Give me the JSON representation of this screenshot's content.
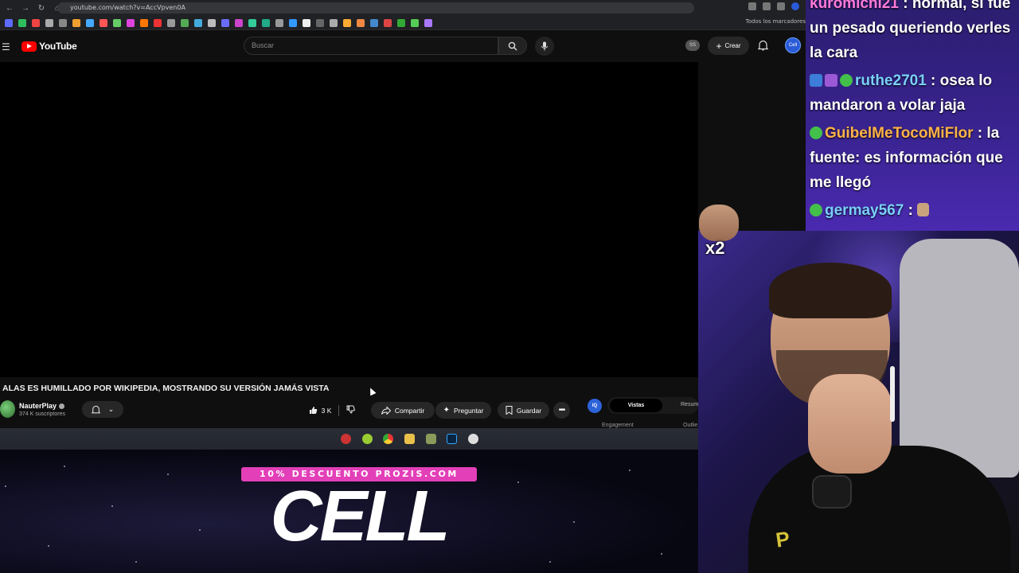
{
  "browser": {
    "url": "youtube.com/watch?v=AccVpven0A",
    "bookmarks_label": "Todos los marcadores"
  },
  "youtube": {
    "logo_text": "YouTube",
    "search_placeholder": "Buscar",
    "ss_badge": "SS",
    "create_label": "Crear",
    "avatar_text": "Cell"
  },
  "video": {
    "title": "ALAS ES HUMILLADO POR WIKIPEDIA, MOSTRANDO SU VERSIÓN JAMÁS VISTA",
    "channel_name": "NauterPlay",
    "subscribers": "374 K suscriptores",
    "likes": "3 K",
    "share_label": "Compartir",
    "ask_label": "Preguntar",
    "save_label": "Guardar"
  },
  "extension": {
    "icon_text": "IQ",
    "tabs": [
      "Vistas",
      "Resum"
    ],
    "sub_labels": [
      "Engagement",
      "Outlie"
    ]
  },
  "banner": {
    "promo_text": "10% DESCUENTO PROZIS.COM",
    "brand_text": "CELL"
  },
  "chat": {
    "messages": [
      {
        "user": "kuromichi21",
        "text": " : normal, si fue un pesado queriendo verles la cara",
        "color": "#ff7ad9"
      },
      {
        "user": "ruthe2701",
        "text": " : osea lo mandaron a volar jaja",
        "color": "#7ad0ff"
      },
      {
        "user": "GuibelMeTocoMiFlor",
        "text": " : la fuente: es información que me llegó",
        "color": "#ffb347"
      },
      {
        "user": "germay567",
        "text": " : ",
        "color": "#7ad0ff"
      }
    ]
  },
  "emote_overlay": {
    "multiplier": "x2"
  },
  "colors": {
    "yt_red": "#ff0000",
    "promo_pink": "#e33fb8",
    "chat_bg": "#3a2492"
  }
}
